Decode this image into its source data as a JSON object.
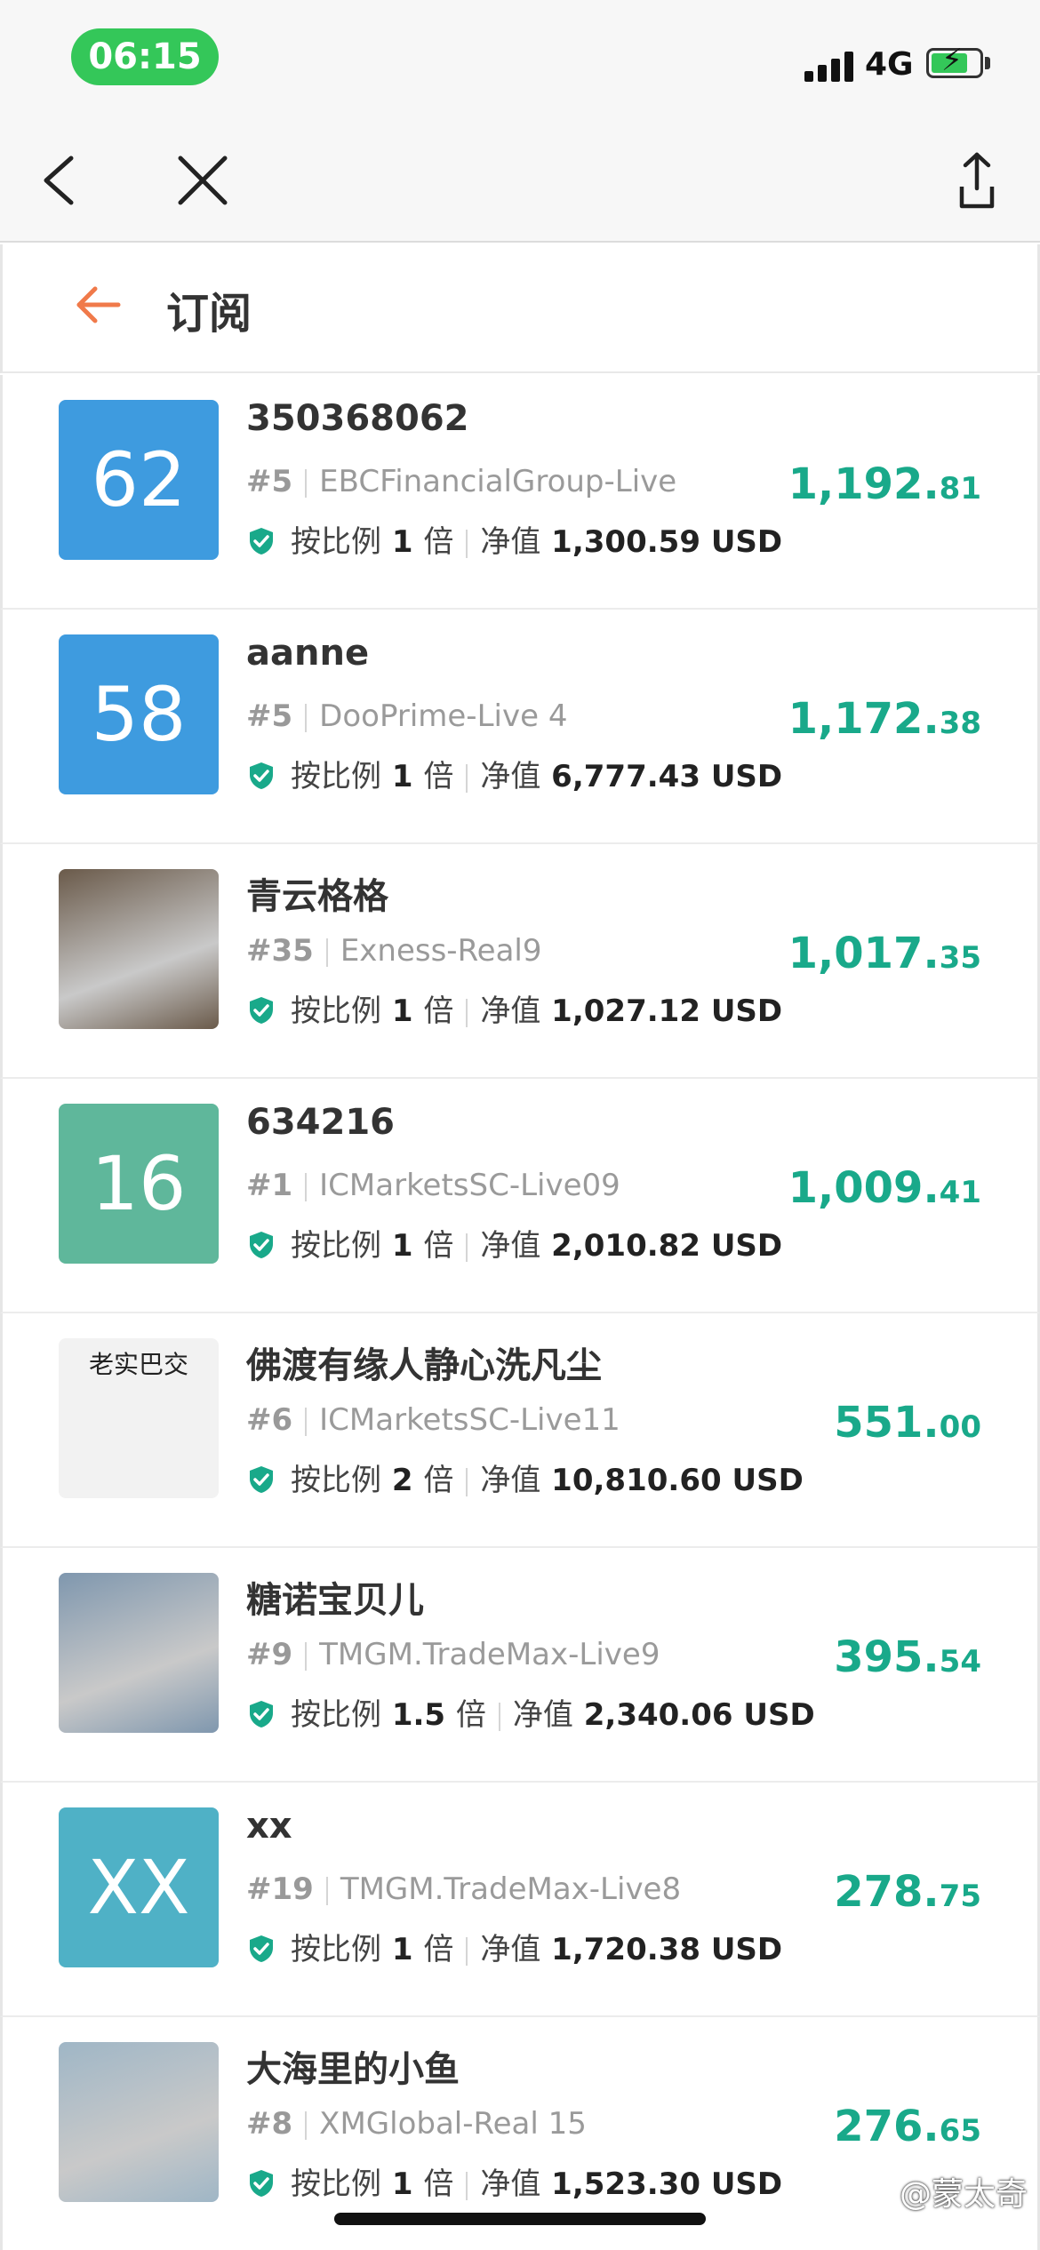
{
  "status_bar": {
    "time": "06:15",
    "network": "4G"
  },
  "header": {
    "title": "订阅"
  },
  "labels": {
    "ratio_prefix": "按比例",
    "ratio_suffix": "倍",
    "equity": "净值",
    "currency": "USD"
  },
  "rows": [
    {
      "name": "350368062",
      "avatar_text": "62",
      "avatar_color": "#3e9bdf",
      "rank": "#5",
      "server": "EBCFinancialGroup-Live",
      "ratio": "1",
      "equity_int": "1,300.",
      "equity_dec": "59",
      "profit_int": "1,192.",
      "profit_dec": "81"
    },
    {
      "name": "aanne",
      "avatar_text": "58",
      "avatar_color": "#3e9bdf",
      "rank": "#5",
      "server": "DooPrime-Live 4",
      "ratio": "1",
      "equity_int": "6,777.",
      "equity_dec": "43",
      "profit_int": "1,172.",
      "profit_dec": "38"
    },
    {
      "name": "青云格格",
      "avatar_text": "",
      "avatar_color": "#6a5a4a",
      "rank": "#35",
      "server": "Exness-Real9",
      "ratio": "1",
      "equity_int": "1,027.",
      "equity_dec": "12",
      "profit_int": "1,017.",
      "profit_dec": "35"
    },
    {
      "name": "634216",
      "avatar_text": "16",
      "avatar_color": "#5fb79b",
      "rank": "#1",
      "server": "ICMarketsSC-Live09",
      "ratio": "1",
      "equity_int": "2,010.",
      "equity_dec": "82",
      "profit_int": "1,009.",
      "profit_dec": "41"
    },
    {
      "name": "佛渡有缘人静心洗凡尘",
      "avatar_text": "老实巴交",
      "avatar_color": "#f2f2f2",
      "rank": "#6",
      "server": "ICMarketsSC-Live11",
      "ratio": "2",
      "equity_int": "10,810.",
      "equity_dec": "60",
      "profit_int": "551.",
      "profit_dec": "00"
    },
    {
      "name": "糖诺宝贝儿",
      "avatar_text": "",
      "avatar_color": "#7f97ae",
      "rank": "#9",
      "server": "TMGM.TradeMax-Live9",
      "ratio": "1.5",
      "equity_int": "2,340.",
      "equity_dec": "06",
      "profit_int": "395.",
      "profit_dec": "54"
    },
    {
      "name": "xx",
      "avatar_text": "XX",
      "avatar_color": "#4fb1c6",
      "rank": "#19",
      "server": "TMGM.TradeMax-Live8",
      "ratio": "1",
      "equity_int": "1,720.",
      "equity_dec": "38",
      "profit_int": "278.",
      "profit_dec": "75"
    },
    {
      "name": "大海里的小鱼",
      "avatar_text": "",
      "avatar_color": "#9fb6c6",
      "rank": "#8",
      "server": "XMGlobal-Real 15",
      "ratio": "1",
      "equity_int": "1,523.",
      "equity_dec": "30",
      "profit_int": "276.",
      "profit_dec": "65"
    }
  ],
  "watermark": "@蒙太奇"
}
